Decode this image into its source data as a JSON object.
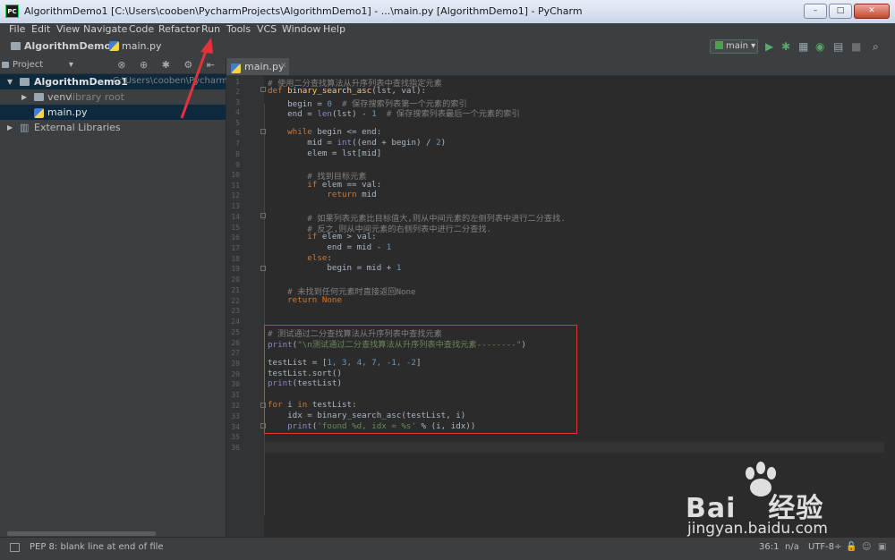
{
  "window": {
    "title": "AlgorithmDemo1 [C:\\Users\\cooben\\PycharmProjects\\AlgorithmDemo1] - ...\\main.py [AlgorithmDemo1] - PyCharm",
    "app_icon": "PC",
    "buttons": {
      "minimize": "–",
      "maximize": "□",
      "close": "✕"
    }
  },
  "menu": [
    "File",
    "Edit",
    "View",
    "Navigate",
    "Code",
    "Refactor",
    "Run",
    "Tools",
    "VCS",
    "Window",
    "Help"
  ],
  "navbar": {
    "project": "AlgorithmDemo1",
    "file": "main.py",
    "run_config": "main",
    "icons": [
      "run-icon",
      "debug-icon",
      "coverage-icon",
      "profile-icon",
      "build-icon",
      "stop-icon",
      "search-icon"
    ]
  },
  "project_panel": {
    "title": "Project",
    "tree": {
      "root": "AlgorithmDemo1",
      "root_path": "C:\\Users\\cooben\\PycharmProjects",
      "venv": "venv",
      "venv_note": "library root",
      "file": "main.py",
      "external": "External Libraries"
    }
  },
  "editor": {
    "tab": "main.py",
    "line_numbers": [
      "1",
      "2",
      "3",
      "4",
      "5",
      "6",
      "7",
      "8",
      "9",
      "10",
      "11",
      "12",
      "13",
      "14",
      "15",
      "16",
      "17",
      "18",
      "19",
      "20",
      "21",
      "22",
      "23",
      "24",
      "25",
      "26",
      "27",
      "28",
      "29",
      "30",
      "31",
      "32",
      "33",
      "34",
      "35",
      "36"
    ],
    "code": {
      "l1": "# 使用二分查找算法从升序列表中查找指定元素",
      "l2_kw": "def ",
      "l2_fn": "binary_search_asc",
      "l2_rest": "(lst, val):",
      "l3a": "    begin = ",
      "l3n": "0",
      "l3c": "  # 保存搜索列表第一个元素的索引",
      "l4a": "    end = ",
      "l4b": "len",
      "l4c": "(lst) - ",
      "l4n": "1",
      "l4d": "  # 保存搜索列表最后一个元素的索引",
      "l6k": "    while",
      "l6r": " begin <= end:",
      "l7a": "        mid = ",
      "l7b": "int",
      "l7c": "((end + begin) / ",
      "l7n": "2",
      "l7d": ")",
      "l8": "        elem = lst[mid]",
      "l10": "        # 找到目标元素",
      "l11k": "        if",
      "l11r": " elem == val:",
      "l12k": "            return",
      "l12r": " mid",
      "l14": "        # 如果列表元素比目标值大,则从中间元素的左侧列表中进行二分查找.",
      "l15": "        # 反之,则从中间元素的右侧列表中进行二分查找.",
      "l16k": "        if",
      "l16r": " elem > val:",
      "l17a": "            end = mid - ",
      "l17n": "1",
      "l18k": "        else",
      "l18r": ":",
      "l19a": "            begin = mid + ",
      "l19n": "1",
      "l21": "    # 未找到任何元素时直接返回None",
      "l22k": "    return",
      "l22r": " None",
      "l25": "# 测试通过二分查找算法从升序列表中查找元素",
      "l26a": "print",
      "l26b": "(",
      "l26s": "\"\\n测试通过二分查找算法从升序列表中查找元素--------\"",
      "l26c": ")",
      "l28a": "testList = [",
      "l28n": "1, 3, 4, 7, -1, -2",
      "l28b": "]",
      "l29": "testList.sort()",
      "l30a": "print",
      "l30b": "(testList)",
      "l32k": "for",
      "l32a": " i ",
      "l32k2": "in",
      "l32b": " testList:",
      "l33": "    idx = binary_search_asc(testList, i)",
      "l34a": "    print",
      "l34b": "(",
      "l34s": "'found %d, idx = %s'",
      "l34c": " % (i, idx))"
    }
  },
  "status": {
    "message": "PEP 8: blank line at end of file",
    "position": "36:1",
    "na": "n/a",
    "encoding": "UTF-8÷"
  },
  "watermark": {
    "brand": "Bai",
    "brand2": "经验",
    "url": "jingyan.baidu.com"
  },
  "colors": {
    "highlight_box": "#e0343a",
    "annotation_arrow": "#e0343a"
  }
}
